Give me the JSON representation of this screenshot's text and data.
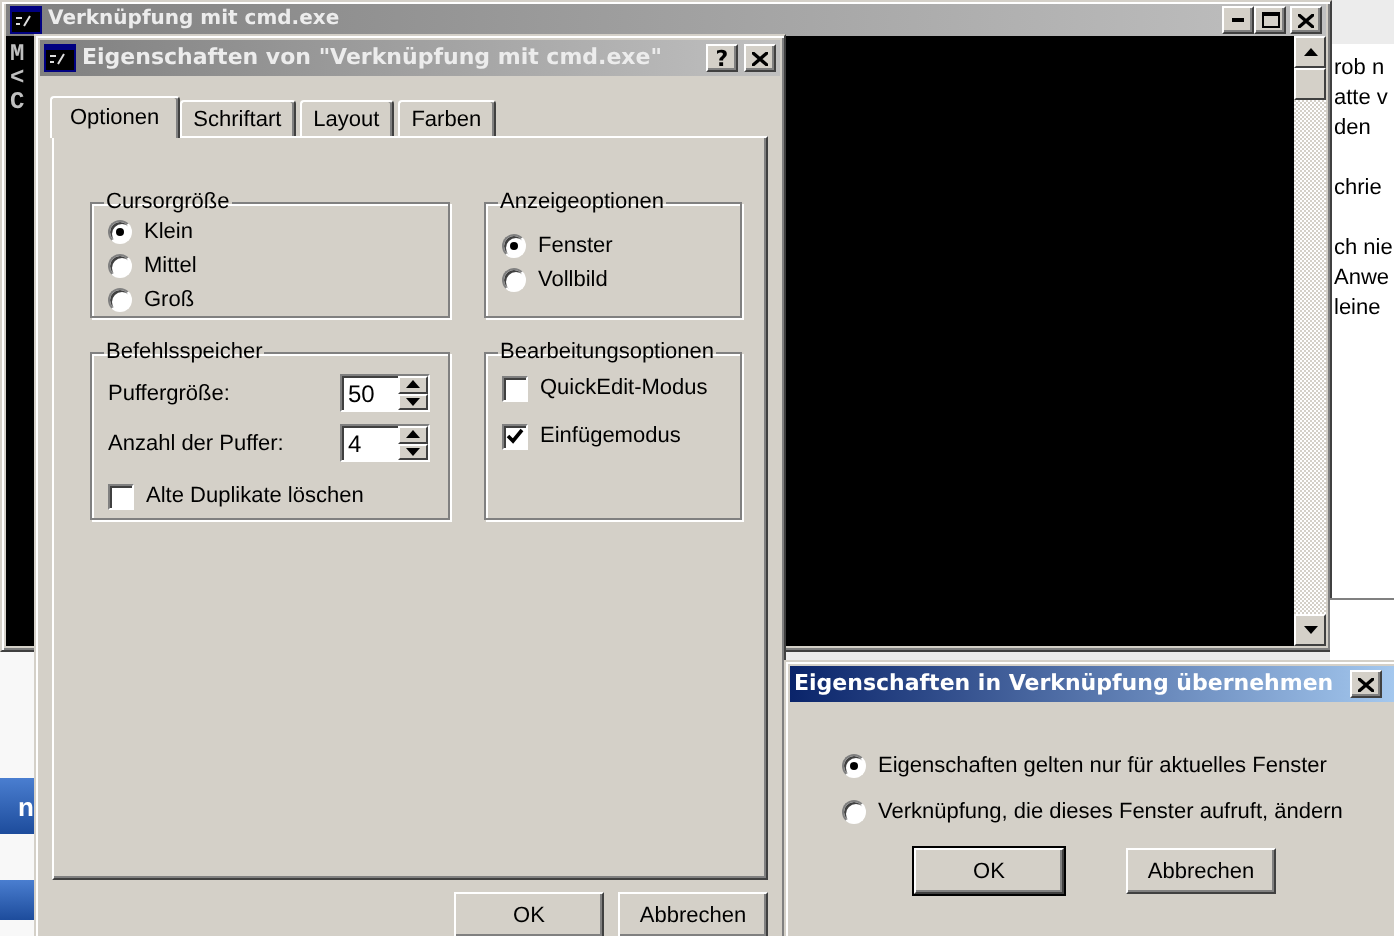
{
  "console_window": {
    "title": "Verknüpfung mit cmd.exe",
    "lines": [
      "M",
      "<",
      "C"
    ]
  },
  "document_paragraphs": [
    [
      "rob n",
      "atte v",
      "den"
    ],
    [
      "chrie"
    ],
    [
      "ch nie",
      "Anwe",
      "leine"
    ]
  ],
  "background_window": {
    "text": "n"
  },
  "properties_dialog": {
    "title": "Eigenschaften von \"Verknüpfung mit cmd.exe\"",
    "help": "?",
    "tabs": [
      {
        "label": "Optionen",
        "selected": true
      },
      {
        "label": "Schriftart",
        "selected": false
      },
      {
        "label": "Layout",
        "selected": false
      },
      {
        "label": "Farben",
        "selected": false
      }
    ],
    "cursor_size": {
      "title": "Cursorgröße",
      "options": [
        {
          "label": "Klein",
          "selected": true
        },
        {
          "label": "Mittel",
          "selected": false
        },
        {
          "label": "Groß",
          "selected": false
        }
      ]
    },
    "display_options": {
      "title": "Anzeigeoptionen",
      "options": [
        {
          "label": "Fenster",
          "selected": true
        },
        {
          "label": "Vollbild",
          "selected": false
        }
      ]
    },
    "command_history": {
      "title": "Befehlsspeicher",
      "fields": [
        {
          "label": "Puffergröße:",
          "value": "50"
        },
        {
          "label": "Anzahl der Puffer:",
          "value": "4"
        }
      ],
      "checkbox": {
        "label": "Alte Duplikate löschen",
        "checked": false
      }
    },
    "edit_options": {
      "title": "Bearbeitungsoptionen",
      "checkboxes": [
        {
          "label": "QuickEdit-Modus",
          "checked": false
        },
        {
          "label": "Einfügemodus",
          "checked": true
        }
      ]
    },
    "buttons": [
      "OK",
      "Abbrechen"
    ]
  },
  "confirm_dialog": {
    "title": "Eigenschaften in Verknüpfung übernehmen",
    "options": [
      {
        "label": "Eigenschaften gelten nur für aktuelles Fenster",
        "selected": true
      },
      {
        "label": "Verknüpfung, die dieses Fenster aufruft, ändern",
        "selected": false
      }
    ],
    "buttons": [
      {
        "label": "OK",
        "default": true
      },
      {
        "label": "Abbrechen",
        "default": false
      }
    ]
  }
}
